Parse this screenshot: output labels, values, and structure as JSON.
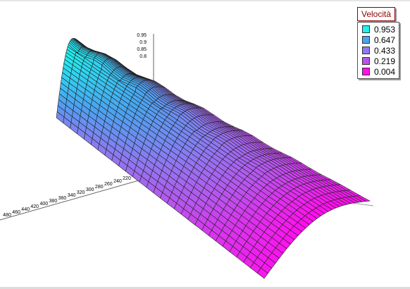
{
  "chart_data": {
    "type": "surface",
    "title": "",
    "z_ticks": [
      "0.95",
      "0.9",
      "0.85",
      "0.8"
    ],
    "y_ticks": [
      "220",
      "240",
      "260",
      "280",
      "300",
      "320",
      "340",
      "360",
      "380",
      "400",
      "420",
      "440",
      "460",
      "480"
    ],
    "legend": {
      "title": "Velocità",
      "placement": "top-right",
      "entries": [
        {
          "label": "0.953",
          "color": "#22f0f0"
        },
        {
          "label": "0.647",
          "color": "#4aa3f0"
        },
        {
          "label": "0.433",
          "color": "#8f78f2"
        },
        {
          "label": "0.219",
          "color": "#bb52ee"
        },
        {
          "label": "0.004",
          "color": "#ff10ee"
        }
      ]
    },
    "surface": {
      "value_range": [
        0.004,
        0.953
      ],
      "peak_value": 0.953,
      "min_value": 0.004
    }
  }
}
